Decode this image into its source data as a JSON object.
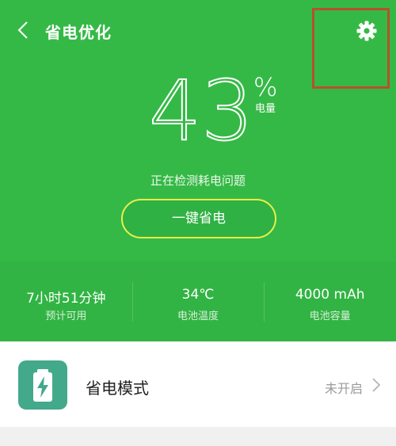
{
  "header": {
    "title": "省电优化"
  },
  "battery": {
    "percent": "43",
    "percent_sign": "%",
    "percent_label": "电量",
    "status_text": "正在检测耗电问题",
    "action_label": "一键省电"
  },
  "stats": [
    {
      "value": "7小时51分钟",
      "label": "预计可用"
    },
    {
      "value": "34℃",
      "label": "电池温度"
    },
    {
      "value": "4000 mAh",
      "label": "电池容量"
    }
  ],
  "mode": {
    "label": "省电模式",
    "status": "未开启"
  },
  "icons": {
    "back": "back-chevron-icon",
    "settings": "gear-icon",
    "mode": "battery-bolt-icon",
    "chevron": "chevron-right-icon"
  },
  "colors": {
    "primary_green": "#35b946",
    "stats_green": "#31b443",
    "button_border": "#e8f04a",
    "mode_icon_bg": "#43a98b",
    "annotation": "#b5522b"
  }
}
